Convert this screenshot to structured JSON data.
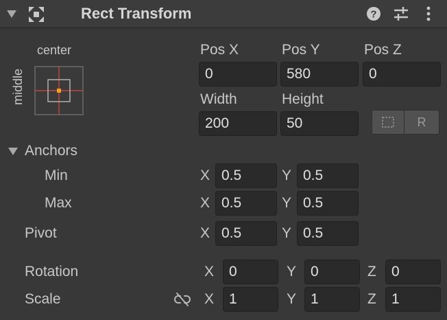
{
  "header": {
    "title": "Rect Transform",
    "icons": [
      "collapse-triangle-icon",
      "rect-transform-icon",
      "help-icon",
      "presets-icon",
      "more-icon"
    ]
  },
  "anchor_preset": {
    "horizontal_label": "center",
    "vertical_label": "middle"
  },
  "position": {
    "pos_x_label": "Pos X",
    "pos_y_label": "Pos Y",
    "pos_z_label": "Pos Z",
    "pos_x": "0",
    "pos_y": "580",
    "pos_z": "0",
    "width_label": "Width",
    "height_label": "Height",
    "width": "200",
    "height": "50",
    "raw_edit_label": "R",
    "blueprint_icon": "dotted-rect-icon"
  },
  "anchors": {
    "label": "Anchors",
    "min_label": "Min",
    "max_label": "Max",
    "min_x": "0.5",
    "min_y": "0.5",
    "max_x": "0.5",
    "max_y": "0.5"
  },
  "pivot": {
    "label": "Pivot",
    "x": "0.5",
    "y": "0.5"
  },
  "rotation": {
    "label": "Rotation",
    "x": "0",
    "y": "0",
    "z": "0"
  },
  "scale": {
    "label": "Scale",
    "x": "1",
    "y": "1",
    "z": "1",
    "link_icon": "unlink-icon"
  },
  "axis_labels": {
    "x": "X",
    "y": "Y",
    "z": "Z"
  },
  "colors": {
    "background": "#383838",
    "field": "#2a2a2a",
    "anchor_line": "#c0453d",
    "anchor_point": "#f0a020"
  }
}
